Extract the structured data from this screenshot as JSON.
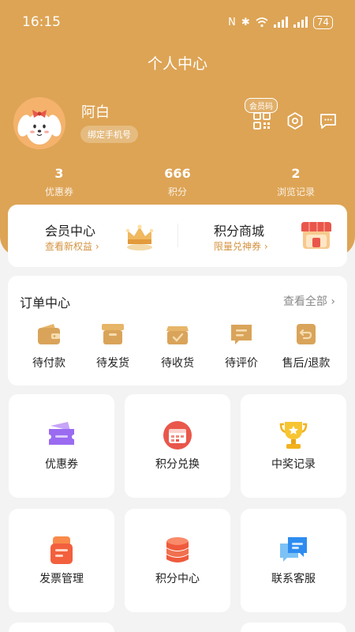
{
  "status_bar": {
    "time": "16:15",
    "battery": "74"
  },
  "header": {
    "title": "个人中心"
  },
  "user": {
    "name": "阿白",
    "bind_phone": "绑定手机号",
    "member_code_tag": "会员码"
  },
  "stats": [
    {
      "value": "3",
      "label": "优惠券"
    },
    {
      "value": "666",
      "label": "积分"
    },
    {
      "value": "2",
      "label": "浏览记录"
    }
  ],
  "promo": {
    "member": {
      "title": "会员中心",
      "subtitle": "查看新权益 ›"
    },
    "mall": {
      "title": "积分商城",
      "subtitle": "限量兑神券 ›"
    }
  },
  "orders": {
    "title": "订单中心",
    "view_all": "查看全部 ›",
    "items": [
      {
        "label": "待付款",
        "icon": "wallet-icon"
      },
      {
        "label": "待发货",
        "icon": "box-icon"
      },
      {
        "label": "待收货",
        "icon": "check-box-icon"
      },
      {
        "label": "待评价",
        "icon": "comment-icon"
      },
      {
        "label": "售后/退款",
        "icon": "return-icon"
      }
    ]
  },
  "grid": [
    {
      "label": "优惠券",
      "icon": "coupon-icon"
    },
    {
      "label": "积分兑换",
      "icon": "calendar-exchange-icon"
    },
    {
      "label": "中奖记录",
      "icon": "trophy-icon"
    },
    {
      "label": "发票管理",
      "icon": "invoice-icon"
    },
    {
      "label": "积分中心",
      "icon": "coin-stack-icon"
    },
    {
      "label": "联系客服",
      "icon": "chat-service-icon"
    }
  ],
  "colors": {
    "header": "#dda455",
    "accent": "#d49340",
    "background": "#f3f3f3"
  }
}
